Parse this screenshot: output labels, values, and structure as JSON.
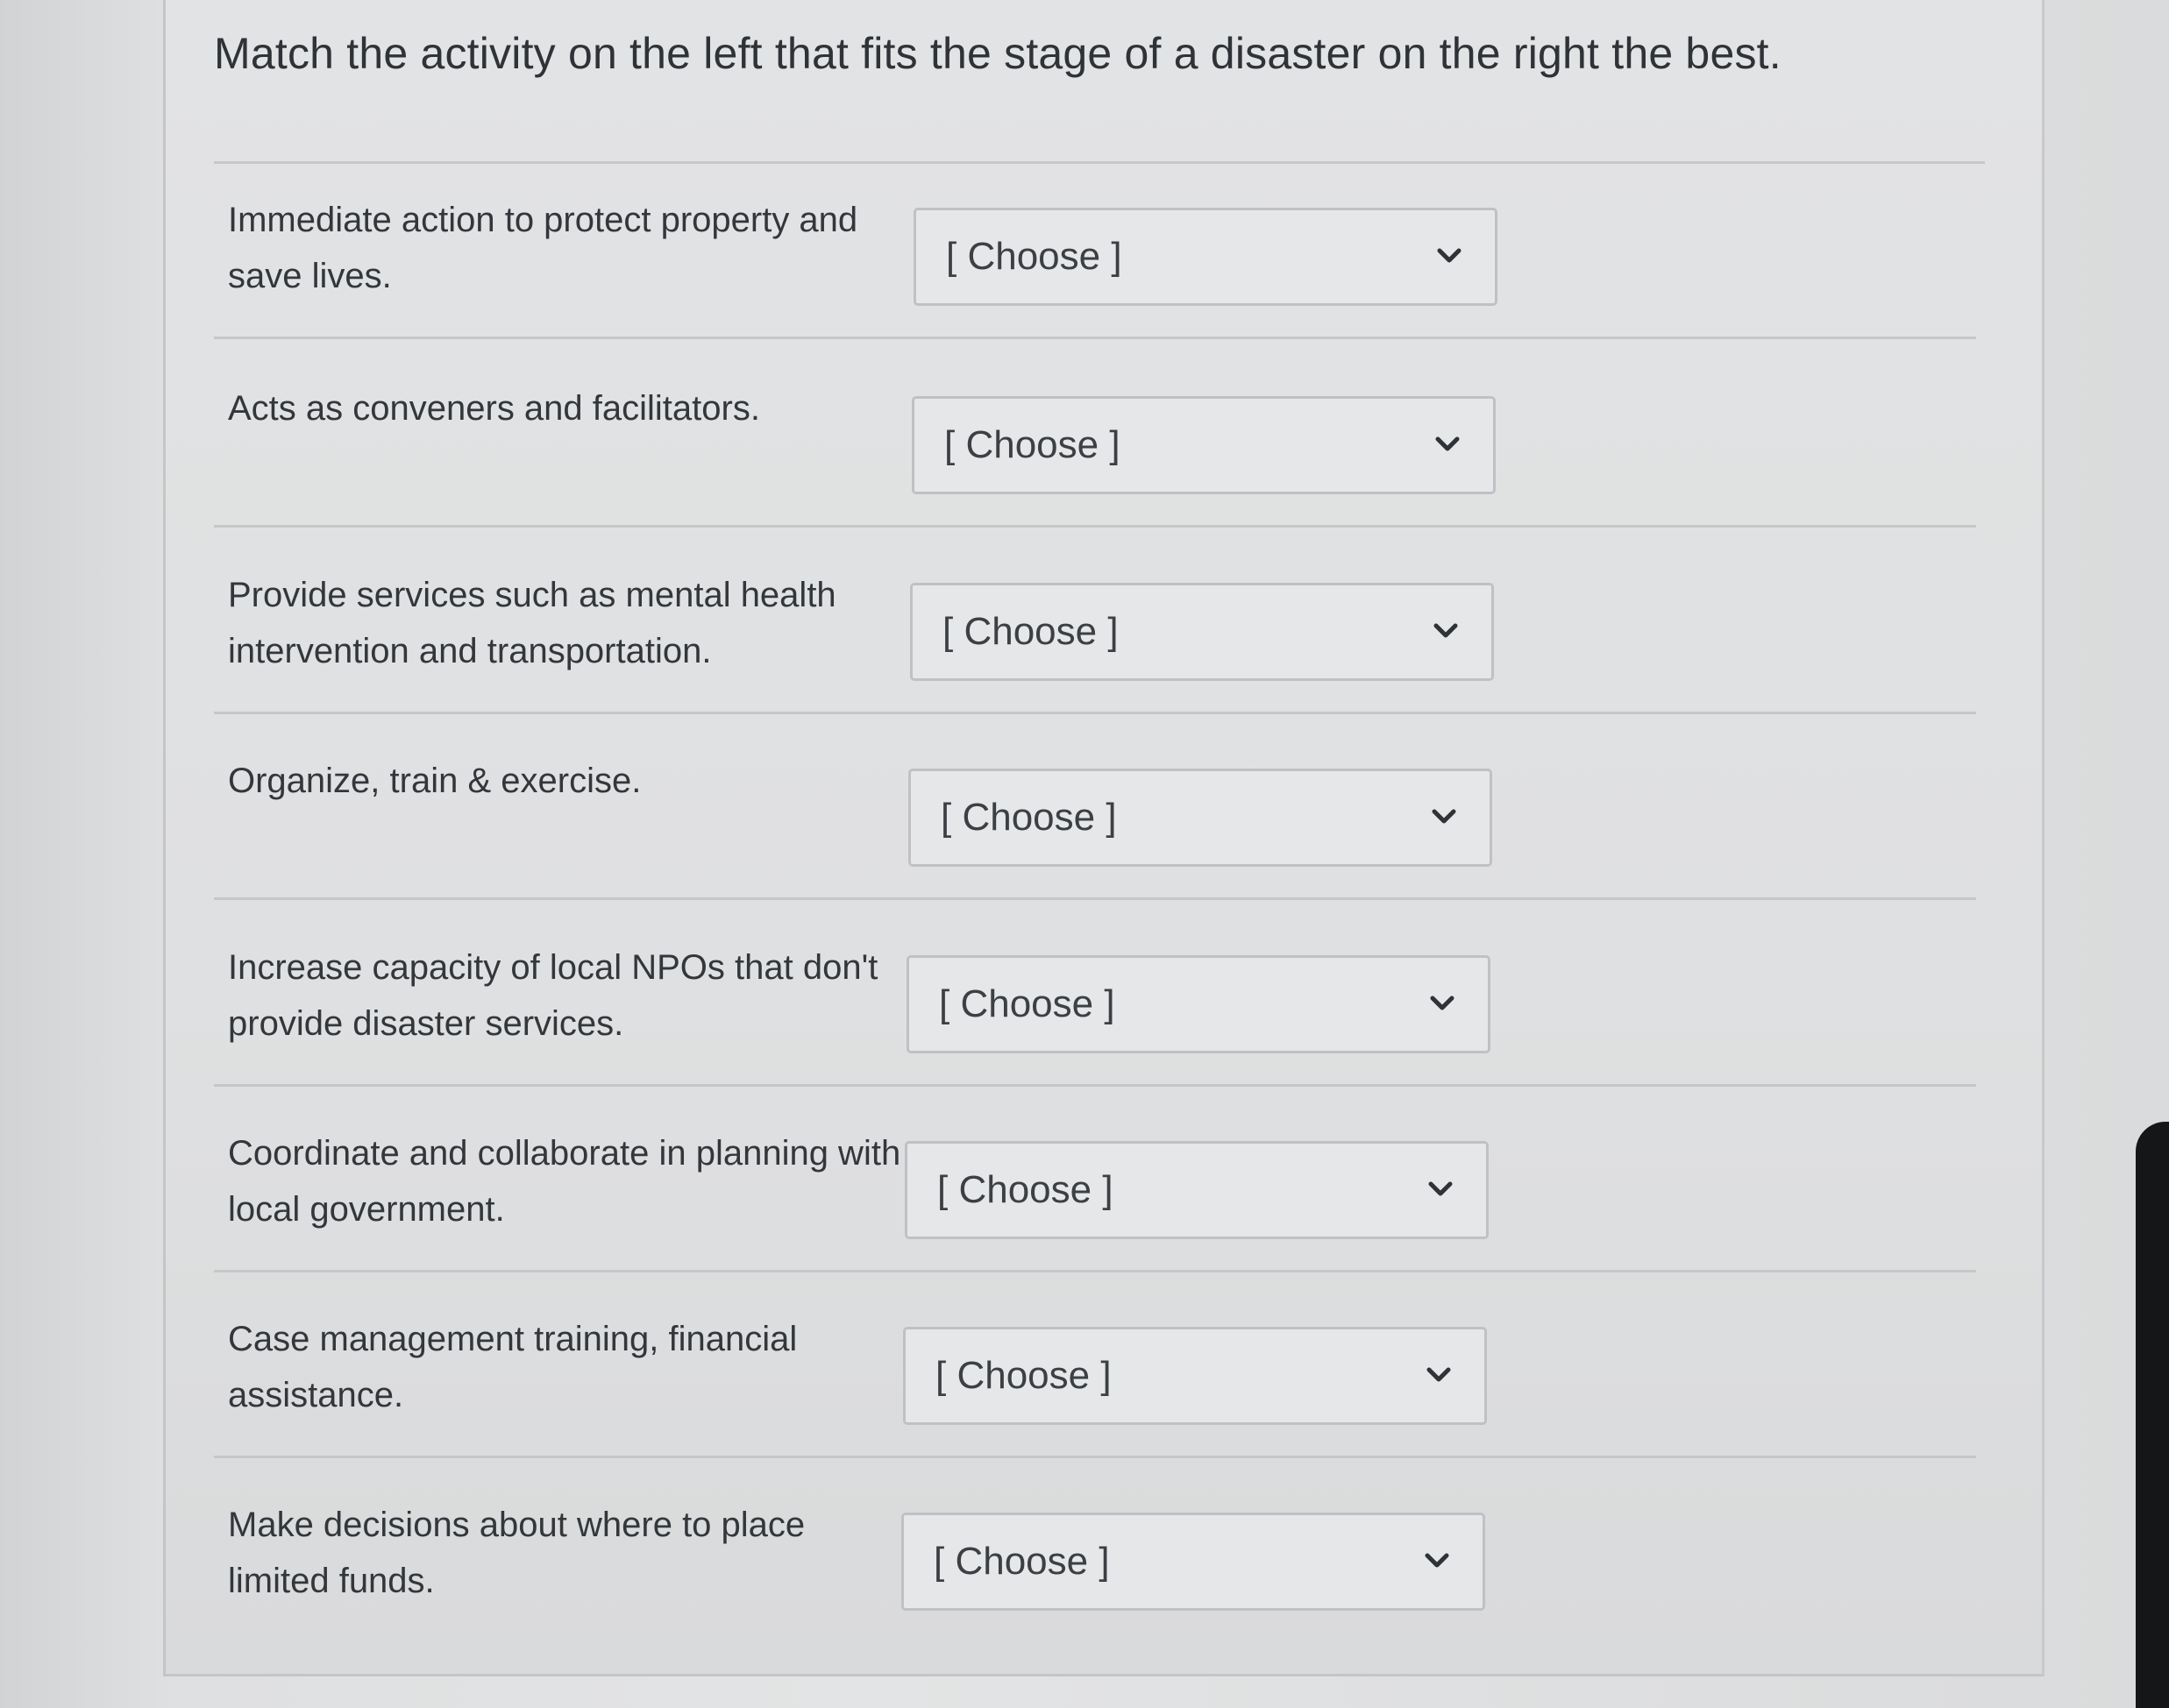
{
  "question": {
    "text": "Match the activity on the left that fits the stage of a disaster on the right the best."
  },
  "rows": [
    {
      "prompt": "Immediate action to protect property and save lives.",
      "selected": "[ Choose ]"
    },
    {
      "prompt": "Acts as conveners and facilitators.",
      "selected": "[ Choose ]"
    },
    {
      "prompt": "Provide services such as mental health intervention and transportation.",
      "selected": "[ Choose ]"
    },
    {
      "prompt": "Organize, train & exercise.",
      "selected": "[ Choose ]"
    },
    {
      "prompt": "Increase capacity of local NPOs that don't provide disaster services.",
      "selected": "[ Choose ]"
    },
    {
      "prompt": "Coordinate and collaborate in planning with local government.",
      "selected": "[ Choose ]"
    },
    {
      "prompt": "Case management training, financial assistance.",
      "selected": "[ Choose ]"
    },
    {
      "prompt": "Make decisions about where to place limited funds.",
      "selected": "[ Choose ]"
    }
  ],
  "icons": {
    "dropdown": "chevron-down-icon"
  },
  "colors": {
    "text": "#33373b",
    "border": "#bfc1c4",
    "background": "#e2e3e4"
  }
}
